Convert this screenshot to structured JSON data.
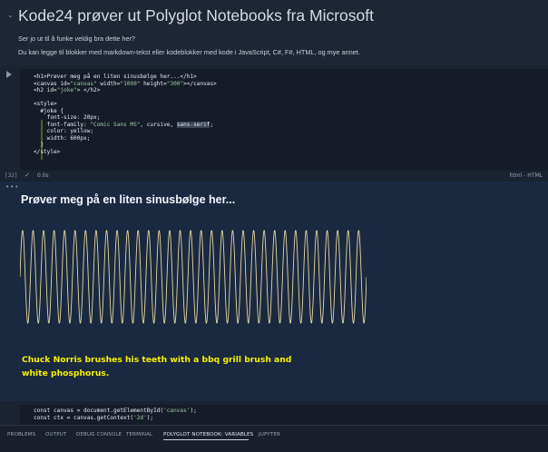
{
  "markdown": {
    "title": "Kode24 prøver ut Polyglot Notebooks fra Microsoft",
    "para1": "Ser jo ut til å funke veldig bra dette her?",
    "para2": "Du kan legge til blokker med markdown-tekst eller kodeblokker med kode i JavaScript, C#, F#, HTML, og mye annet."
  },
  "code_cell": {
    "lines": [
      "<h1>Prøver meg på en liten sinusbølge her...</h1>",
      "<canvas id=\"canvas\" width=\"1000\" height=\"300\"></canvas>",
      "<h2 id=\"joke\"> </h2>",
      "",
      "<style>",
      "  #joke {",
      "    font-size: 20px;",
      "    font-family: \"Comic Sans MS\", cursive, sans-serif;",
      "    color: yellow;",
      "    width: 600px;",
      "  }",
      "</style>"
    ],
    "execution_count": "[32]",
    "exec_time": "0.0s",
    "language": "html - HTML"
  },
  "output": {
    "heading": "Prøver meg på en liten sinusbølge her...",
    "joke": "Chuck Norris brushes his teeth with a bbq grill brush and white phosphorus."
  },
  "sine_wave": {
    "cycles": 33,
    "stroke_color": "#e5d9a0"
  },
  "code_cell2": {
    "lines": [
      "const canvas = document.getElementById('canvas');",
      "const ctx = canvas.getContext('2d');"
    ]
  },
  "panel": {
    "tabs": [
      "PROBLEMS",
      "OUTPUT",
      "DEBUG CONSOLE",
      "TERMINAL",
      "POLYGLOT NOTEBOOK: VARIABLES",
      "JUPYTER"
    ],
    "active": "POLYGLOT NOTEBOOK: VARIABLES"
  },
  "icons": {
    "collapse": "chevron-down-icon",
    "run": "run-cell-icon",
    "success": "check-icon",
    "more": "more-dots-icon"
  }
}
